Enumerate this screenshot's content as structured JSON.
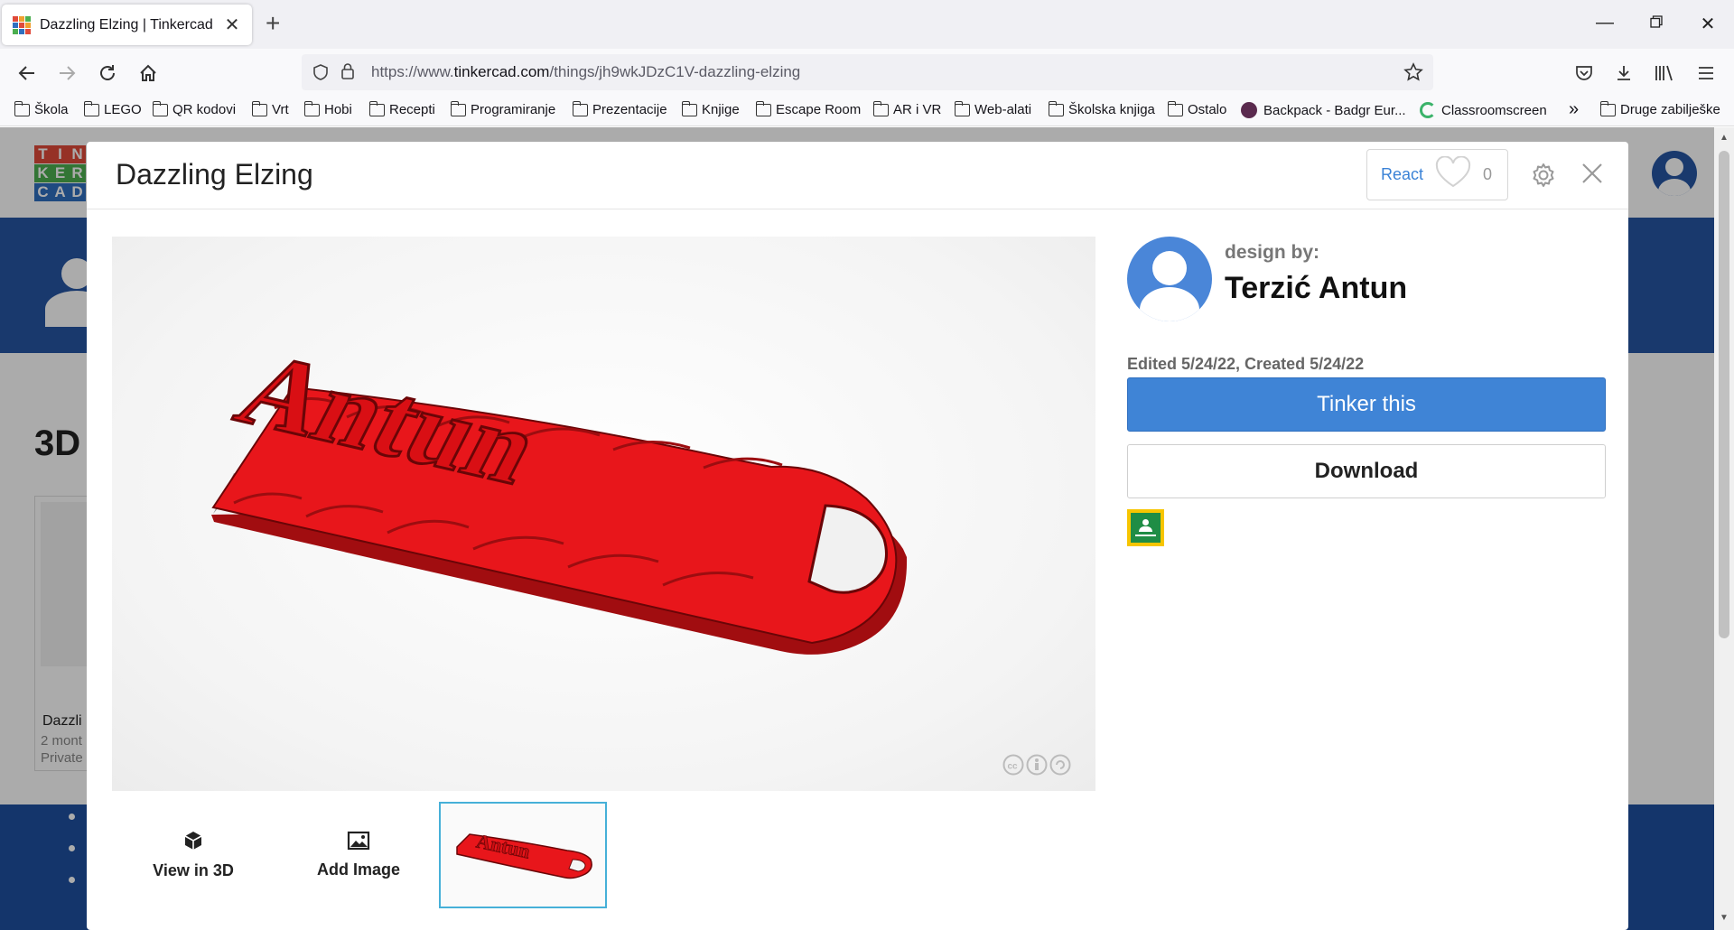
{
  "browser": {
    "tab_title": "Dazzling Elzing | Tinkercad",
    "url_prefix": "https://www.",
    "url_domain": "tinkercad.com",
    "url_path": "/things/jh9wkJDzC1V-dazzling-elzing",
    "bookmarks": [
      "Škola",
      "LEGO",
      "QR kodovi",
      "Vrt",
      "Hobi",
      "Recepti",
      "Programiranje",
      "Prezentacije",
      "Knjige",
      "Escape Room",
      "AR i VR",
      "Web-alati",
      "Školska knjiga",
      "Ostalo",
      "Backpack - Badgr Eur...",
      "Classroomscreen"
    ],
    "other_bookmarks": "Druge zabilješke",
    "overflow": "»"
  },
  "background_page": {
    "logo_letters": [
      "TIN",
      "KER",
      "CAD"
    ],
    "heading": "3D",
    "card_title": "Dazzli",
    "card_time": "2 mont",
    "card_privacy": "Private"
  },
  "modal": {
    "title": "Dazzling Elzing",
    "react_label": "React",
    "react_count": "0",
    "design_by_label": "design by:",
    "designer_name": "Terzić Antun",
    "dates": "Edited 5/24/22, Created 5/24/22",
    "tinker_label": "Tinker this",
    "download_label": "Download",
    "model_text": "Antun",
    "view3d_label": "View in 3D",
    "add_image_label": "Add Image"
  },
  "colors": {
    "accent": "#3f84d6",
    "model_red": "#e8161b",
    "tinkercad_blue": "#2656a3"
  }
}
